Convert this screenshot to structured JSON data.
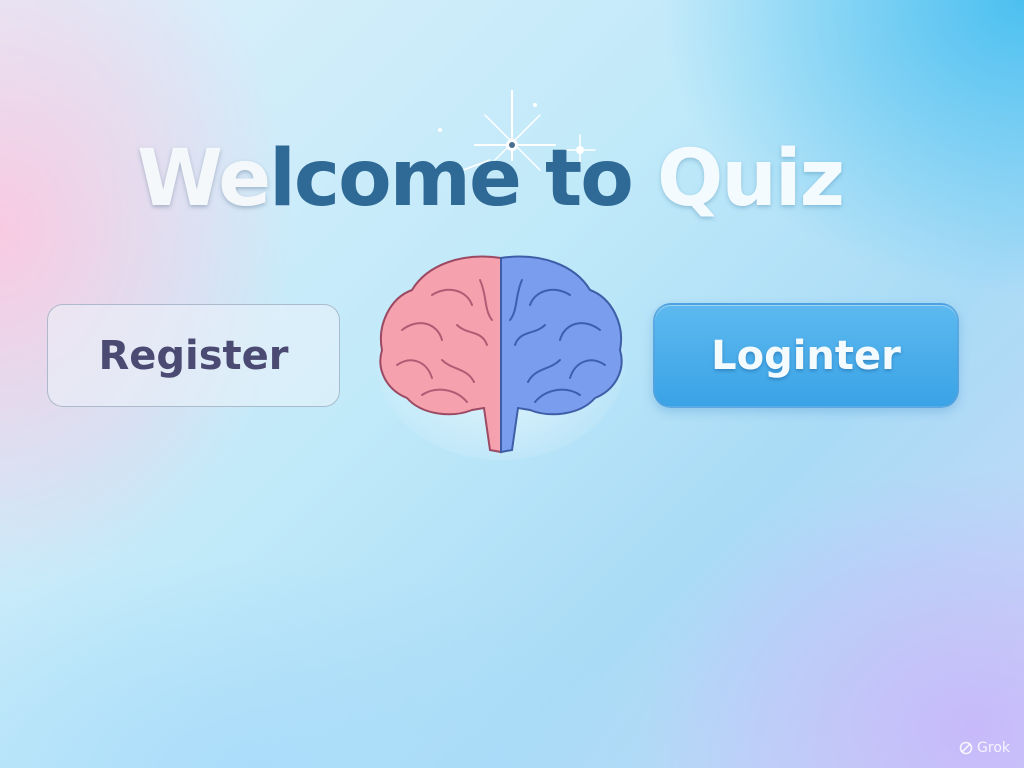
{
  "header": {
    "title_part1": "We",
    "title_part2": "lcome to ",
    "title_part3": "Quiz"
  },
  "actions": {
    "register_label": "Register",
    "login_label": "Loginter"
  },
  "watermark": {
    "label": "Grok",
    "icon": "grok-logo-icon"
  },
  "illustration": {
    "icon": "brain-icon",
    "colors": {
      "left_hemisphere": "#f49aa8",
      "right_hemisphere": "#6f96ea"
    }
  },
  "colors": {
    "accent": "#3aa3e6",
    "title_dark": "#2f6a96",
    "register_text": "#4a4a72"
  }
}
